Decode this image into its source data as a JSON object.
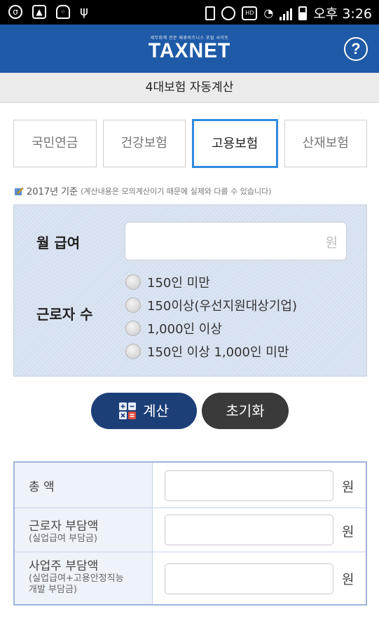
{
  "status_bar": {
    "time": "오후 3:26",
    "left_icons": [
      "notification-icon",
      "image-icon",
      "android-icon",
      "usb-icon"
    ],
    "right_icons": [
      "vibrate-icon",
      "alarm-icon",
      "wifi-icon",
      "signal-icon",
      "battery-icon"
    ]
  },
  "header": {
    "logo_sub": "세무회계 전문 제휴비즈니스 포털 사이트",
    "logo": "TAXNET",
    "help_label": "?"
  },
  "title": "4대보험 자동계산",
  "tabs": [
    {
      "label": "국민연금",
      "active": false
    },
    {
      "label": "건강보험",
      "active": false
    },
    {
      "label": "고용보험",
      "active": true
    },
    {
      "label": "산재보험",
      "active": false
    }
  ],
  "notice": {
    "main": "2017년 기준",
    "sub": "(계산내용은 모의계산이기 때문에 실제와 다를 수 있습니다)"
  },
  "form": {
    "salary_label": "월 급여",
    "salary_unit": "원",
    "salary_value": "",
    "workers_label": "근로자 수",
    "worker_options": [
      "150인 미만",
      "150이상(우선지원대상기업)",
      "1,000인 이상",
      "150인 이상 1,000인 미만"
    ]
  },
  "buttons": {
    "calc": "계산",
    "reset": "초기화"
  },
  "results": [
    {
      "label": "총 액",
      "sub": "",
      "unit": "원",
      "value": ""
    },
    {
      "label": "근로자 부담액",
      "sub": "(실업급여 부담금)",
      "unit": "원",
      "value": ""
    },
    {
      "label": "사업주 부담액",
      "sub": "(실업급여+고용안정직능\n개발 부담금)",
      "unit": "원",
      "value": ""
    }
  ],
  "colors": {
    "header_bg": "#1e5aa7",
    "active_tab_border": "#2f8be0",
    "calc_button": "#1d3f78",
    "reset_button": "#3a3a3a"
  }
}
